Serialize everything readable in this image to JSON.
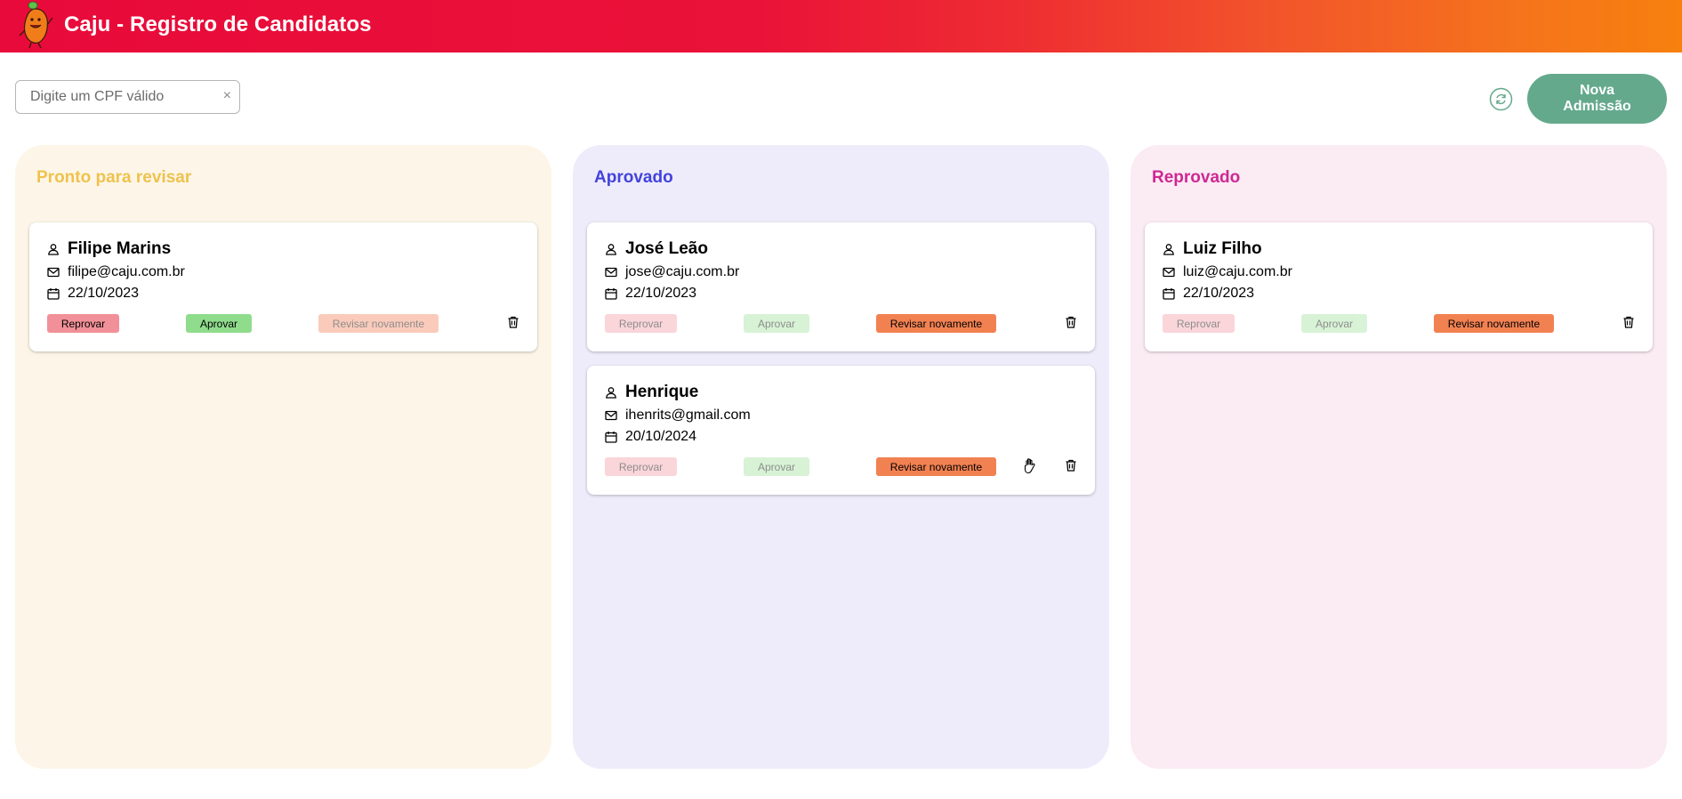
{
  "header": {
    "title": "Caju - Registro de Candidatos"
  },
  "search": {
    "placeholder": "Digite um CPF válido",
    "value": "",
    "clear_symbol": "×"
  },
  "toolbar": {
    "refresh_icon": "refresh-icon",
    "new_button_label": "Nova Admissão"
  },
  "buttons": {
    "reprove": "Reprovar",
    "approve": "Aprovar",
    "review_again": "Revisar novamente"
  },
  "columns": [
    {
      "title": "Pronto para revisar",
      "color": "#efc24d",
      "background": "#fdf6e8",
      "cards": [
        {
          "name": "Filipe Marins",
          "email": "filipe@caju.com.br",
          "date": "22/10/2023",
          "enabled_actions": [
            "Reprovar",
            "Aprovar"
          ]
        }
      ]
    },
    {
      "title": "Aprovado",
      "color": "#4242df",
      "background": "#eeecfa",
      "cards": [
        {
          "name": "José Leão",
          "email": "jose@caju.com.br",
          "date": "22/10/2023",
          "enabled_actions": [
            "Revisar novamente"
          ]
        },
        {
          "name": "Henrique",
          "email": "ihenrits@gmail.com",
          "date": "20/10/2024",
          "enabled_actions": [
            "Revisar novamente"
          ]
        }
      ]
    },
    {
      "title": "Reprovado",
      "color": "#ce2893",
      "background": "#fbebf3",
      "cards": [
        {
          "name": "Luiz Filho",
          "email": "luiz@caju.com.br",
          "date": "22/10/2023",
          "enabled_actions": [
            "Revisar novamente"
          ]
        }
      ]
    }
  ],
  "colors": {
    "header_start": "#e80a3b",
    "header_end": "#f7800e",
    "primary_button": "#64a98c",
    "reprove": "#f19098",
    "approve": "#8fdc8c",
    "review_again": "#f28152"
  }
}
